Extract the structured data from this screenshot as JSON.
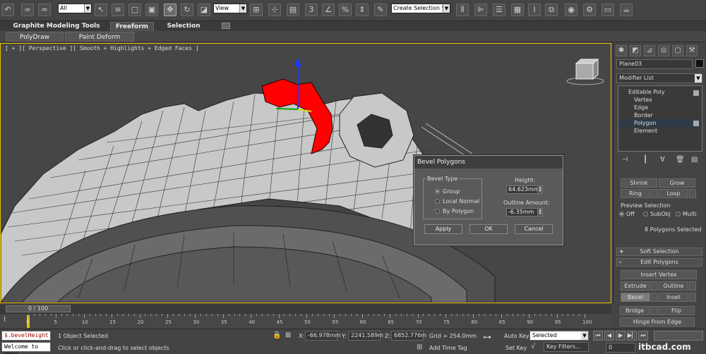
{
  "toolbar": {
    "selection_filter": "All",
    "ref_coord": "View",
    "named_selection_placeholder": "Create Selection Se"
  },
  "ribbon": {
    "tabs": [
      {
        "label": "Graphite Modeling Tools"
      },
      {
        "label": "Freeform"
      },
      {
        "label": "Selection"
      }
    ],
    "subtabs": [
      {
        "label": "PolyDraw"
      },
      {
        "label": "Paint Deform"
      }
    ]
  },
  "viewport": {
    "label": "[ + ][ Perspective ][ Smooth + Highlights + Edged Faces ]"
  },
  "dialog": {
    "title": "Bevel Polygons",
    "bevel_type_label": "Bevel Type",
    "options": [
      "Group",
      "Local Normal",
      "By Polygon"
    ],
    "height_label": "Height:",
    "height_value": "64.623mm",
    "outline_label": "Outline Amount:",
    "outline_value": "-6.35mm",
    "apply": "Apply",
    "ok": "OK",
    "cancel": "Cancel"
  },
  "command_panel": {
    "object_name": "Plane03",
    "modifier_list": "Modifier List",
    "stack": [
      "Editable Poly",
      "Vertex",
      "Edge",
      "Border",
      "Polygon",
      "Element"
    ],
    "shrink": "Shrink",
    "grow": "Grow",
    "ring": "Ring",
    "loop": "Loop",
    "preview_selection": "Preview Selection",
    "preview_options": [
      "Off",
      "SubObj",
      "Multi"
    ],
    "selected_count": "8 Polygons Selected",
    "soft_selection": "Soft Selection",
    "edit_polygons": "Edit Polygons",
    "insert_vertex": "Insert Vertex",
    "extrude": "Extrude",
    "outline": "Outline",
    "bevel": "Bevel",
    "inset": "Inset",
    "bridge": "Bridge",
    "flip": "Flip",
    "hinge_from_edge": "Hinge From Edge",
    "plus": "+",
    "minus": "-"
  },
  "timeline": {
    "frame_display": "0 / 100",
    "ticks": [
      "0",
      "5",
      "10",
      "15",
      "20",
      "25",
      "30",
      "35",
      "40",
      "45",
      "50",
      "55",
      "60",
      "65",
      "70",
      "75",
      "80",
      "85",
      "90",
      "95",
      "100"
    ]
  },
  "status": {
    "maxscript_1": "$.bevelHeight :",
    "maxscript_2": "Welcome to MAX!",
    "selected": "1 Object Selected",
    "prompt": "Click or click-and-drag to select objects",
    "x_label": "X:",
    "x_value": "-66.978mm",
    "y_label": "Y:",
    "y_value": "2241.589m",
    "z_label": "Z:",
    "z_value": "6852.776m",
    "grid": "Grid = 254.0mm",
    "add_time_tag": "Add Time Tag",
    "auto_key": "Auto Key",
    "set_key": "Set Key",
    "key_mode": "Selected",
    "key_filters": "Key Filters...",
    "frame": "0",
    "watermark": "itbcad.com"
  },
  "colors": {
    "selection_red": "#ff0000",
    "viewport_border": "#e8c000",
    "mesh_face": "#c8c8c8"
  }
}
